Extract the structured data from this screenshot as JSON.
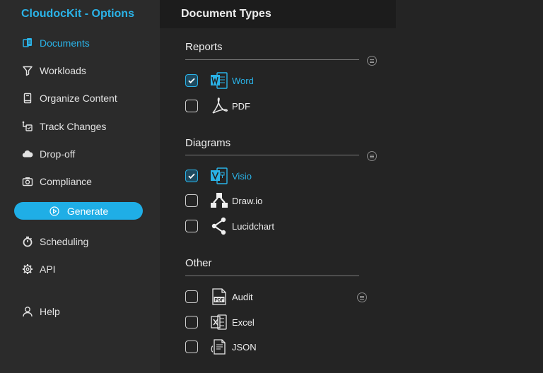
{
  "app": {
    "title": "CloudocKit - Options"
  },
  "header": {
    "title": "Document Types"
  },
  "sidebar": {
    "items": [
      {
        "label": "Documents",
        "icon": "documents-icon",
        "active": true
      },
      {
        "label": "Workloads",
        "icon": "filter-icon"
      },
      {
        "label": "Organize Content",
        "icon": "book-icon"
      },
      {
        "label": "Track Changes",
        "icon": "track-changes-icon"
      },
      {
        "label": "Drop-off",
        "icon": "cloud-icon"
      },
      {
        "label": "Compliance",
        "icon": "camera-icon"
      },
      {
        "label": "Scheduling",
        "icon": "stopwatch-icon"
      },
      {
        "label": "API",
        "icon": "gear-icon"
      },
      {
        "label": "Help",
        "icon": "person-icon"
      }
    ],
    "generate_label": "Generate"
  },
  "sections": [
    {
      "title": "Reports",
      "options": [
        {
          "label": "Word",
          "checked": true,
          "icon": "word-icon"
        },
        {
          "label": "PDF",
          "checked": false,
          "icon": "pdf-icon"
        }
      ]
    },
    {
      "title": "Diagrams",
      "options": [
        {
          "label": "Visio",
          "checked": true,
          "icon": "visio-icon"
        },
        {
          "label": "Draw.io",
          "checked": false,
          "icon": "drawio-icon"
        },
        {
          "label": "Lucidchart",
          "checked": false,
          "icon": "lucidchart-icon"
        }
      ]
    },
    {
      "title": "Other",
      "options": [
        {
          "label": "Audit",
          "checked": false,
          "icon": "pdf-file-icon"
        },
        {
          "label": "Excel",
          "checked": false,
          "icon": "excel-icon"
        },
        {
          "label": "JSON",
          "checked": false,
          "icon": "json-icon"
        }
      ]
    }
  ],
  "colors": {
    "accent": "#2ab3e8",
    "sidebar_bg": "#2b2b2b",
    "main_bg": "#242424",
    "header_bg": "#1c1c1c"
  }
}
